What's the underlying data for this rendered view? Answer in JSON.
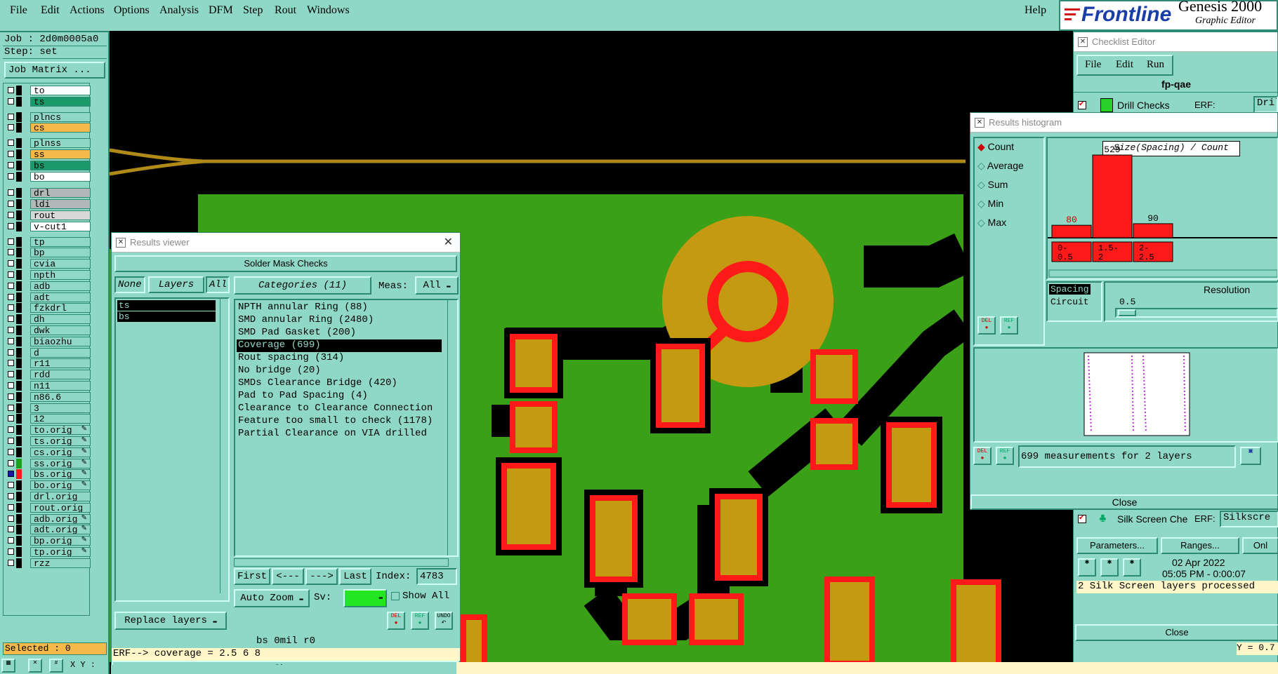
{
  "menubar": {
    "items": [
      "File",
      "Edit",
      "Actions",
      "Options",
      "Analysis",
      "DFM",
      "Step",
      "Rout",
      "Windows"
    ],
    "help": "Help",
    "brand_logo": "Frontline",
    "brand_product": "Genesis 2000",
    "brand_sub": "Graphic Editor"
  },
  "left_panel": {
    "job": "Job : 2d0m0005a0",
    "step": "Step: set",
    "job_matrix": "Job Matrix ...",
    "selected": "Selected : 0",
    "xy": "X Y :",
    "layers": [
      {
        "name": "to",
        "color": "#ffffff"
      },
      {
        "name": "ts",
        "color": "#1a9a6a"
      },
      {
        "name": "plncs",
        "color": "#8fd8c6"
      },
      {
        "name": "cs",
        "color": "#f5b84a"
      },
      {
        "name": "plnss",
        "color": "#8fd8c6"
      },
      {
        "name": "ss",
        "color": "#f5b84a"
      },
      {
        "name": "bs",
        "color": "#1a9a6a"
      },
      {
        "name": "bo",
        "color": "#ffffff"
      },
      {
        "name": "drl",
        "color": "#b0b8b8"
      },
      {
        "name": "ldi",
        "color": "#b0b8b8"
      },
      {
        "name": "rout",
        "color": "#d8d8d8"
      },
      {
        "name": "v-cut1",
        "color": "#ffffff"
      },
      {
        "name": "tp",
        "color": "#8fd8c6"
      },
      {
        "name": "bp",
        "color": "#8fd8c6"
      },
      {
        "name": "cvia",
        "color": "#8fd8c6"
      },
      {
        "name": "npth",
        "color": "#8fd8c6"
      },
      {
        "name": "adb",
        "color": "#8fd8c6"
      },
      {
        "name": "adt",
        "color": "#8fd8c6"
      },
      {
        "name": "fzkdrl",
        "color": "#8fd8c6"
      },
      {
        "name": "dh",
        "color": "#8fd8c6"
      },
      {
        "name": "dwk",
        "color": "#8fd8c6"
      },
      {
        "name": "biaozhu",
        "color": "#8fd8c6"
      },
      {
        "name": "d",
        "color": "#8fd8c6"
      },
      {
        "name": "r11",
        "color": "#8fd8c6"
      },
      {
        "name": "rdd",
        "color": "#8fd8c6"
      },
      {
        "name": "n11",
        "color": "#8fd8c6"
      },
      {
        "name": "n86.6",
        "color": "#8fd8c6"
      },
      {
        "name": "3",
        "color": "#8fd8c6"
      },
      {
        "name": "12",
        "color": "#8fd8c6"
      },
      {
        "name": "to.orig",
        "color": "#8fd8c6"
      },
      {
        "name": "ts.orig",
        "color": "#8fd8c6"
      },
      {
        "name": "cs.orig",
        "color": "#8fd8c6"
      },
      {
        "name": "ss.orig",
        "color": "#8fd8c6"
      },
      {
        "name": "bs.orig",
        "color": "#8fd8c6"
      },
      {
        "name": "bo.orig",
        "color": "#8fd8c6"
      },
      {
        "name": "drl.orig",
        "color": "#8fd8c6"
      },
      {
        "name": "rout.orig",
        "color": "#8fd8c6"
      },
      {
        "name": "adb.orig",
        "color": "#8fd8c6"
      },
      {
        "name": "adt.orig",
        "color": "#8fd8c6"
      },
      {
        "name": "bp.orig",
        "color": "#8fd8c6"
      },
      {
        "name": "tp.orig",
        "color": "#8fd8c6"
      },
      {
        "name": "rzz",
        "color": "#8fd8c6"
      }
    ]
  },
  "results_viewer": {
    "title": "Results viewer",
    "header": "Solder Mask Checks",
    "none": "None",
    "layers_label": "Layers",
    "all": "All",
    "categories_label": "Categories (11)",
    "meas_label": "Meas:",
    "meas_value": "All",
    "layer_items": [
      "ts",
      "bs"
    ],
    "categories": [
      "NPTH annular Ring (88)",
      "SMD annular Ring (2480)",
      "SMD Pad Gasket (200)",
      "Coverage (699)",
      "Rout spacing (314)",
      "No bridge (20)",
      "SMDs Clearance Bridge (420)",
      "Pad to Pad Spacing (4)",
      "Clearance to Clearance Connection",
      "Feature too small to check (1178)",
      "Partial Clearance on VIA drilled"
    ],
    "first": "First",
    "prev": "<---",
    "next": "--->",
    "last": "Last",
    "index_label": "Index:",
    "index_value": "4783",
    "auto_zoom": "Auto Zoom",
    "sv_label": "Sv:",
    "show_all": "Show All",
    "replace_layers": "Replace layers",
    "del": "DEL",
    "ref": "REF",
    "undo": "UNDO",
    "status": "bs 0mil  r0",
    "erf": "ERF--> coverage = 2.5 6 8",
    "close": "Close"
  },
  "checklist_editor": {
    "title": "Checklist Editor",
    "menu": [
      "File",
      "Edit",
      "Run"
    ],
    "checklist_name": "fp-qae",
    "drill_checks": "Drill Checks",
    "erf_label": "ERF:",
    "drill_erf": "Drill (N",
    "silk_checks": "Silk Screen Che",
    "silk_erf": "Silkscre",
    "parameters": "Parameters...",
    "ranges": "Ranges...",
    "only": "Onl",
    "date": "02 Apr 2022",
    "time": "05:05 PM - 0:00:07",
    "processed": "2 Silk Screen layers processed",
    "close": "Close",
    "y_readout": "Y = 0.7"
  },
  "histogram": {
    "title": "Results histogram",
    "options": [
      "Count",
      "Average",
      "Sum",
      "Min",
      "Max"
    ],
    "selected_option": "Count",
    "chart_title": "Size(Spacing) / Count",
    "spacing": "Spacing",
    "circuit": "Circuit",
    "resolution_label": "Resolution",
    "resolution_value": "0.5",
    "measurements": "699 measurements for 2 layers",
    "close": "Close",
    "del": "DEL",
    "ref": "REF"
  },
  "chart_data": {
    "type": "bar",
    "title": "Size(Spacing) / Count",
    "categories": [
      "0-0.5",
      "1.5-2",
      "2-2.5"
    ],
    "values": [
      80,
      529,
      90
    ],
    "ylim": [
      0,
      529
    ],
    "bar_color": "#ff1a1a"
  }
}
